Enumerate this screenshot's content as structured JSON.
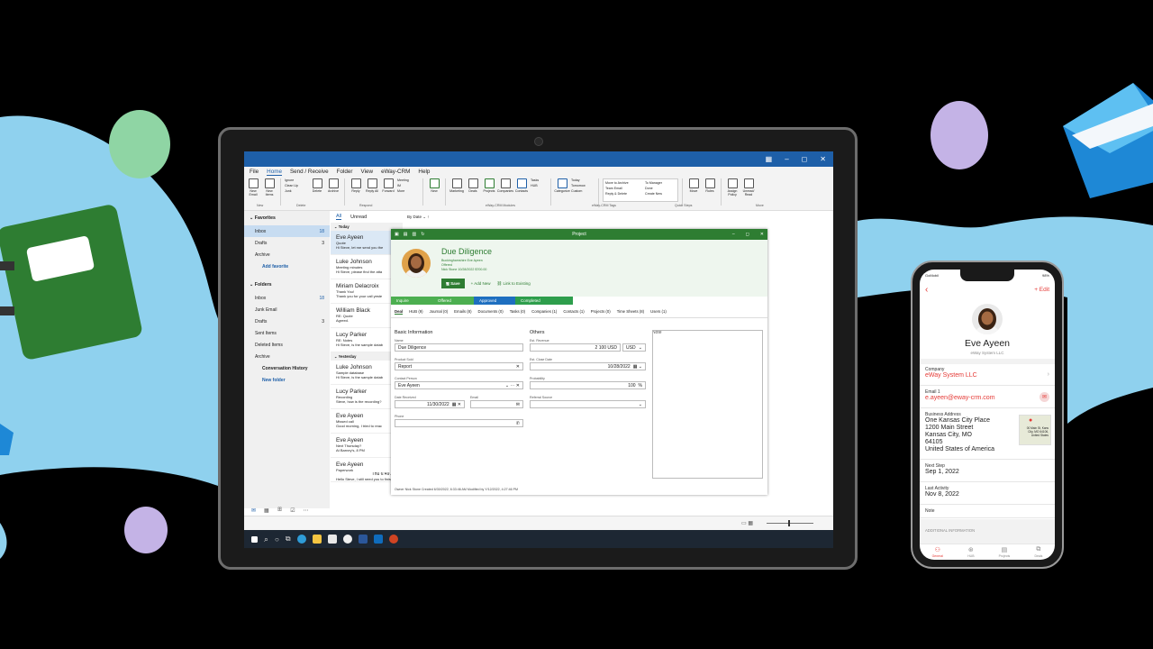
{
  "colors": {
    "accent": "#1e5fa8",
    "crm_green": "#2e7d32",
    "phone_red": "#e53935",
    "backdrop_blue": "#8fd1ee"
  },
  "outlook": {
    "menu": [
      "File",
      "Home",
      "Send / Receive",
      "Folder",
      "View",
      "eWay-CRM",
      "Help"
    ],
    "ribbon": {
      "buttons": [
        {
          "label": "New Email",
          "icon": "mail-icon"
        },
        {
          "label": "New Items",
          "icon": "items-icon"
        },
        {
          "label": "Delete",
          "icon": "trash-icon"
        },
        {
          "label": "Archive",
          "icon": "archive-icon"
        },
        {
          "label": "Reply",
          "icon": "reply-icon"
        },
        {
          "label": "Reply All",
          "icon": "reply-all-icon"
        },
        {
          "label": "Forward",
          "icon": "forward-icon"
        },
        {
          "label": "New",
          "icon": "crm-new-icon"
        },
        {
          "label": "Marketing",
          "icon": "megaphone-icon"
        },
        {
          "label": "Deals",
          "icon": "deals-icon"
        },
        {
          "label": "Projects",
          "icon": "projects-icon"
        },
        {
          "label": "Companies",
          "icon": "building-icon"
        },
        {
          "label": "Contacts",
          "icon": "contact-icon"
        },
        {
          "label": "Categorize",
          "icon": "tag-icon"
        },
        {
          "label": "Move",
          "icon": "move-icon"
        },
        {
          "label": "Rules",
          "icon": "rules-icon"
        },
        {
          "label": "Assign Policy",
          "icon": "policy-icon"
        },
        {
          "label": "Unread/ Read",
          "icon": "envelope-open-icon"
        }
      ],
      "small": {
        "ignore": "Ignore",
        "cleanup": "Clean Up",
        "junk": "Junk",
        "meeting": "Meeting",
        "im": "IM",
        "more": "More",
        "tasks": "Tasks",
        "hub": "HUB",
        "today": "Today",
        "tomorrow": "Tomorrow",
        "custom": "Custom",
        "move_archive": "Move to Archive",
        "team_email": "Team Email",
        "reply_delete": "Reply & Delete",
        "to_manager": "To Manager",
        "done": "Done",
        "create_new": "Create New"
      },
      "groups": {
        "new": "New",
        "delete": "Delete",
        "respond": "Respond",
        "modules": "eWay-CRM Modules",
        "tags": "eWay-CRM Tags",
        "quick": "Quick Steps",
        "move": "Move"
      }
    },
    "sidebar": {
      "favorites": "Favorites",
      "fav_items": [
        {
          "label": "Inbox",
          "count": "18"
        },
        {
          "label": "Drafts",
          "count": "3"
        },
        {
          "label": "Archive",
          "count": ""
        }
      ],
      "add_favorite": "Add favorite",
      "folders": "Folders",
      "folder_items": [
        {
          "label": "Inbox",
          "count": "18"
        },
        {
          "label": "Junk Email",
          "count": ""
        },
        {
          "label": "Drafts",
          "count": "3"
        },
        {
          "label": "Sent Items",
          "count": ""
        },
        {
          "label": "Deleted Items",
          "count": ""
        },
        {
          "label": "Archive",
          "count": ""
        }
      ],
      "conversation_history": "Conversation History",
      "new_folder": "New folder"
    },
    "list": {
      "tab_all": "All",
      "tab_unread": "Unread",
      "sort": "By Date",
      "today": "Today",
      "yesterday": "Yesterday",
      "mails_today": [
        {
          "name": "Eve Ayeen",
          "subject": "Quote",
          "preview": "Hi Steve, let me send you the"
        },
        {
          "name": "Luke Johnson",
          "subject": "Meeting minutes",
          "preview": "Hi Steve, please find the atta"
        },
        {
          "name": "Miriam Delacroix",
          "subject": "Thank You!",
          "preview": "Thank you for your call yeste"
        },
        {
          "name": "William Black",
          "subject": "RE: Quote",
          "preview": "Agreed."
        },
        {
          "name": "Lucy Parker",
          "subject": "RE: Notes",
          "preview": "Hi Steve, is the sample datab"
        }
      ],
      "mails_yesterday": [
        {
          "name": "Luke Johnson",
          "subject": "Sample database",
          "preview": "Hi Steve, is the sample datab"
        },
        {
          "name": "Lucy Parker",
          "subject": "Recording",
          "preview": "Steve, how is the recording?"
        },
        {
          "name": "Eve Ayeen",
          "subject": "Missed call",
          "preview": "Good morning, I tried to reac"
        },
        {
          "name": "Eve Ayeen",
          "subject": "Next Thursday?",
          "preview": "At Barney's, 8 PM"
        },
        {
          "name": "Eve Ayeen",
          "subject": "Paperwork",
          "preview": "Hello Steve, I still need you to finish",
          "time": "Thu 6:49 AM"
        }
      ]
    }
  },
  "project": {
    "window_title": "Project",
    "title": "Due Diligence",
    "company": "Buckinghamshire",
    "contact": "Eve Ayeen",
    "state": "Offered",
    "summary": "Nick Stone  10/28/2022  $700.00",
    "save": "Save",
    "add_new": "Add New",
    "link_existing": "Link to Existing",
    "pipeline": [
      "Inquire",
      "Offered",
      "Approved",
      "Completed"
    ],
    "tabs": [
      "Deal",
      "HUB (9)",
      "Journal (0)",
      "Emails (8)",
      "Documents (0)",
      "Tasks (0)",
      "Companies (1)",
      "Contacts (1)",
      "Projects (0)",
      "Time Sheets (8)",
      "Users (1)"
    ],
    "sections": {
      "basic": "Basic Information",
      "others": "Others",
      "note": "Note"
    },
    "fields": {
      "name_label": "Name",
      "name": "Due Diligence",
      "product_label": "Product Sold",
      "product": "Report",
      "contact_label": "Contact Person",
      "contact": "Eve Ayeen",
      "date_label": "Date Received",
      "date": "11/30/2022",
      "email_label": "Email",
      "phone_label": "Phone",
      "revenue_label": "Est. Revenue",
      "revenue": "2 100 USD",
      "currency": "USD",
      "close_label": "Est. Close Date",
      "close": "10/28/2022",
      "prob_label": "Probability",
      "prob": "100",
      "prob_unit": "%",
      "referral_label": "Referral Source"
    },
    "footer": "Owner Nick Stone  Created 6/30/2022, 6:33:46 AM    Modified by Y/12/2022, 4:27:46 PM"
  },
  "phone": {
    "carrier": "GoMobil",
    "battery": "98%",
    "edit": "Edit",
    "name": "Eve Ayeen",
    "company_sub": "eWay System LLC",
    "company_label": "Company",
    "company": "eWay System LLC",
    "email_label": "Email 1",
    "email": "e.ayeen@eway-crm.com",
    "address_label": "Business Address",
    "address": [
      "One Kansas City Place",
      "1200 Main Street",
      "Kansas City, MO",
      "64105",
      "United States of America"
    ],
    "map_text": "00 Main St, Kans City, MO 64106, United States",
    "next_step_label": "Next Step",
    "next_step": "Sep 1, 2022",
    "last_activity_label": "Last Activity",
    "last_activity": "Nov 8, 2022",
    "note_label": "Note",
    "additional": "ADDITIONAL INFORMATION",
    "nav": [
      "General",
      "HUB",
      "Projects",
      "Deals"
    ]
  }
}
